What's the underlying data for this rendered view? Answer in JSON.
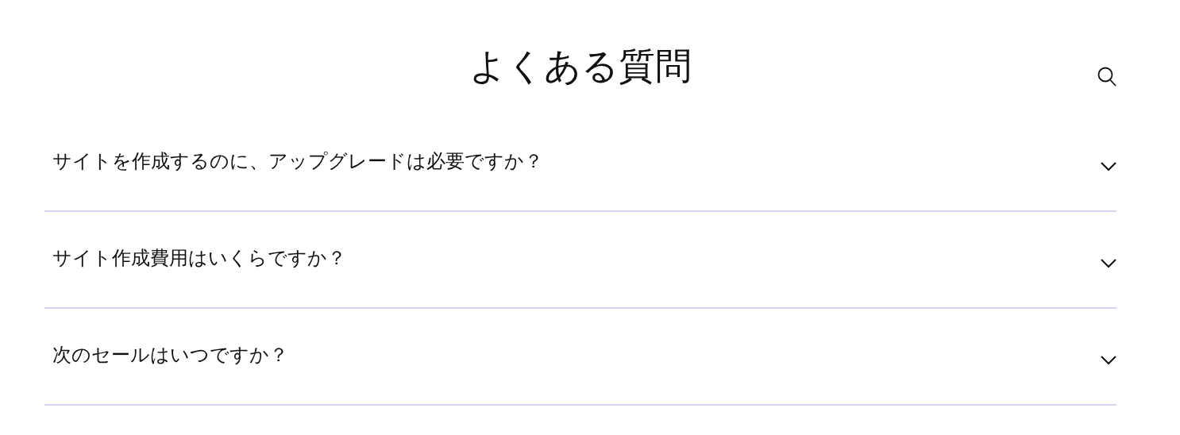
{
  "title": "よくある質問",
  "faq": [
    {
      "question": "サイトを作成するのに、アップグレードは必要ですか？",
      "expanded": false
    },
    {
      "question": "サイト作成費用はいくらですか？",
      "expanded": false
    },
    {
      "question": "次のセールはいつですか？",
      "expanded": false
    }
  ]
}
